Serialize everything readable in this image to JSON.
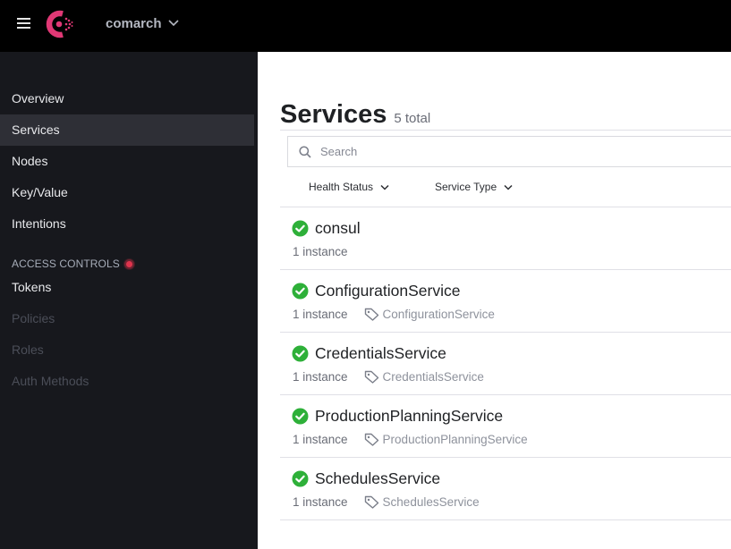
{
  "topbar": {
    "menu_icon": "hamburger-icon",
    "logo": "consul-logo",
    "datacenter": "comarch",
    "brand_color": "#e03875"
  },
  "sidebar": {
    "items": [
      {
        "label": "Overview",
        "active": false,
        "disabled": false
      },
      {
        "label": "Services",
        "active": true,
        "disabled": false
      },
      {
        "label": "Nodes",
        "active": false,
        "disabled": false
      },
      {
        "label": "Key/Value",
        "active": false,
        "disabled": false
      },
      {
        "label": "Intentions",
        "active": false,
        "disabled": false
      }
    ],
    "access_controls": {
      "title": "ACCESS CONTROLS",
      "status_color": "#e0344d",
      "items": [
        {
          "label": "Tokens",
          "disabled": false
        },
        {
          "label": "Policies",
          "disabled": true
        },
        {
          "label": "Roles",
          "disabled": true
        },
        {
          "label": "Auth Methods",
          "disabled": true
        }
      ]
    }
  },
  "main": {
    "title": "Services",
    "total": "5 total",
    "search": {
      "placeholder": "Search",
      "value": ""
    },
    "filters": [
      {
        "label": "Health Status"
      },
      {
        "label": "Service Type"
      }
    ],
    "health_color": "#2eb039",
    "services": [
      {
        "name": "consul",
        "instances": "1 instance",
        "tag": null,
        "status": "passing"
      },
      {
        "name": "ConfigurationService",
        "instances": "1 instance",
        "tag": "ConfigurationService",
        "status": "passing"
      },
      {
        "name": "CredentialsService",
        "instances": "1 instance",
        "tag": "CredentialsService",
        "status": "passing"
      },
      {
        "name": "ProductionPlanningService",
        "instances": "1 instance",
        "tag": "ProductionPlanningService",
        "status": "passing"
      },
      {
        "name": "SchedulesService",
        "instances": "1 instance",
        "tag": "SchedulesService",
        "status": "passing"
      }
    ]
  }
}
